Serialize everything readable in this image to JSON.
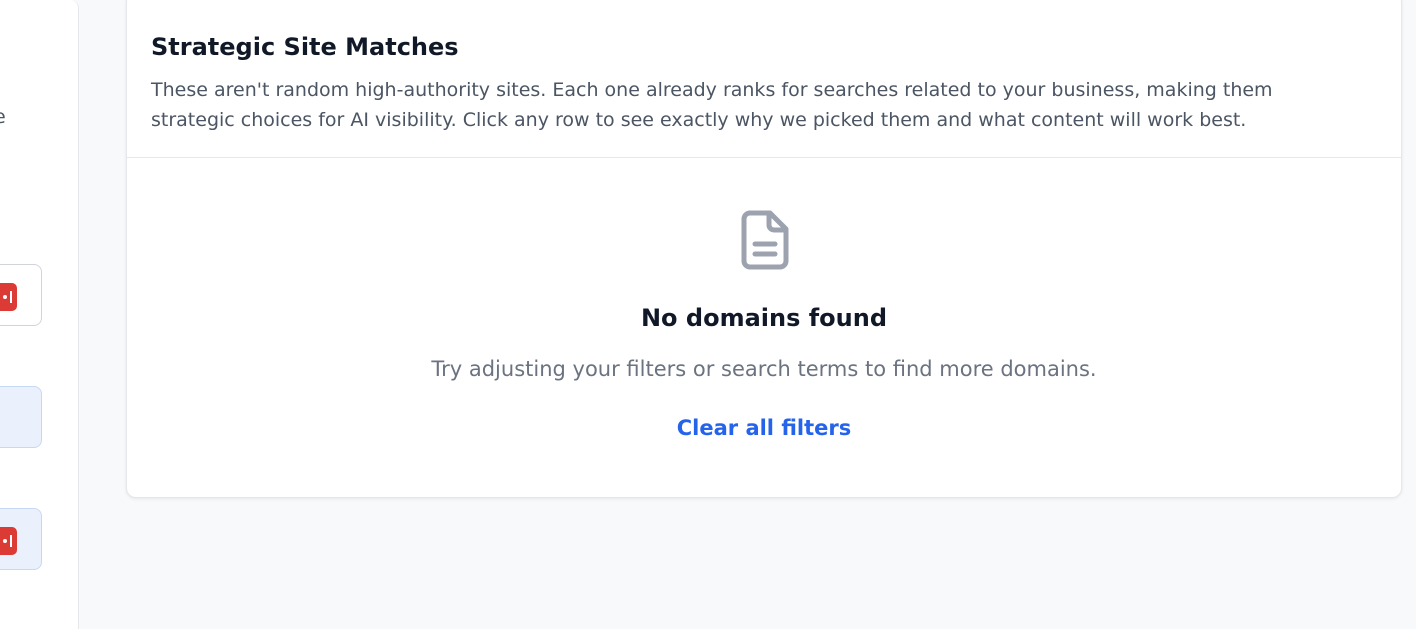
{
  "left_panel": {
    "fragment_text": "e"
  },
  "header": {
    "title": "Strategic Site Matches",
    "description": "These aren't random high-authority sites. Each one already ranks for searches related to your business, making them strategic choices for AI visibility. Click any row to see exactly why we picked them and what content will work best."
  },
  "empty_state": {
    "icon": "document-icon",
    "title": "No domains found",
    "subtitle": "Try adjusting your filters or search terms to find more domains.",
    "clear_label": "Clear all filters"
  },
  "colors": {
    "accent": "#2563eb",
    "badge_red": "#dc3a35",
    "selected_bg": "#eaf1fd",
    "page_bg": "#f8f9fb"
  }
}
